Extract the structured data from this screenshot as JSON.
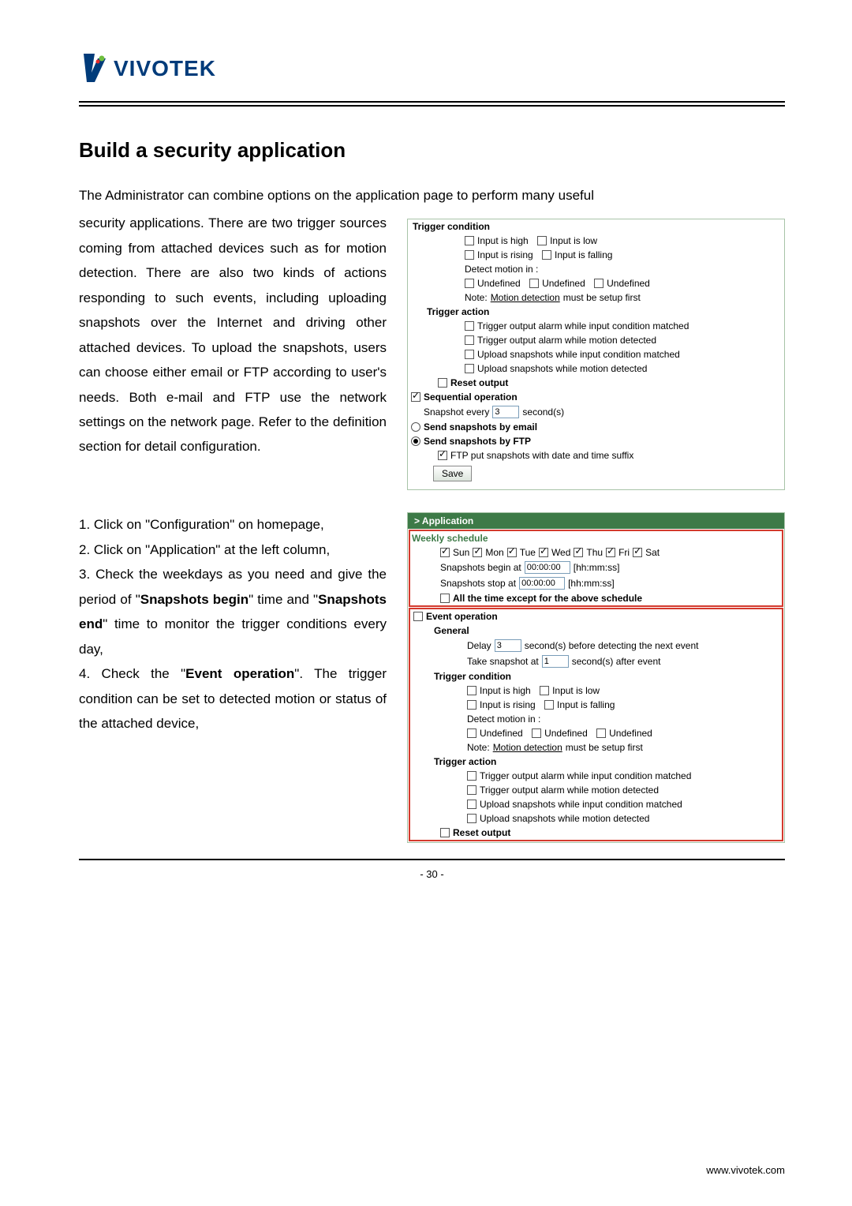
{
  "logo": {
    "brand": "VIVOTEK"
  },
  "h1": "Build a security application",
  "intro": "The Administrator can combine options on the application page to perform many useful",
  "para1": "security applications. There are two trigger sources coming from attached devices such as for motion detection. There are also two kinds of actions responding to such events, including uploading snapshots over the Internet and driving other attached devices. To upload the snapshots, users can choose either email or FTP according to user's needs. Both e-mail and FTP use the network settings on the network page. Refer to the definition section for detail configuration.",
  "steps": {
    "s1a": "1. Click on \"Configuration\" on homepage,",
    "s2": "2. Click on \"Application\" at the left column,",
    "s3a": "3. Check the weekdays as you need and give the period of \"",
    "s3b": "Snapshots begin",
    "s3c": "\" time and \"",
    "s3d": "Snapshots end",
    "s3e": "\" time to monitor the trigger conditions every day,",
    "s4a": "4. Check the \"",
    "s4b": "Event operation",
    "s4c": "\". The trigger condition can be set to detected motion or status of the attached device,"
  },
  "panel1": {
    "trigger_condition": "Trigger condition",
    "input_high": "Input is high",
    "input_low": "Input is low",
    "input_rising": "Input is rising",
    "input_falling": "Input is falling",
    "detect_motion": "Detect motion in :",
    "undef": "Undefined",
    "note_pre": "Note: ",
    "note_link": "Motion detection",
    "note_post": " must be setup first",
    "trigger_action": "Trigger action",
    "ta1": "Trigger output alarm while input condition matched",
    "ta2": "Trigger output alarm while motion detected",
    "ta3": "Upload snapshots while input condition matched",
    "ta4": "Upload snapshots while motion detected",
    "reset_output": "Reset output",
    "seq_op": "Sequential operation",
    "snap_every_pre": "Snapshot every",
    "snap_every_val": "3",
    "snap_every_post": "second(s)",
    "send_email": "Send snapshots by email",
    "send_ftp": "Send snapshots by FTP",
    "ftp_suffix": "FTP put snapshots with date and time suffix",
    "save": "Save"
  },
  "panel2": {
    "app_hdr": "> Application",
    "weekly": "Weekly schedule",
    "days": {
      "sun": "Sun",
      "mon": "Mon",
      "tue": "Tue",
      "wed": "Wed",
      "thu": "Thu",
      "fri": "Fri",
      "sat": "Sat"
    },
    "snap_begin_pre": "Snapshots begin at",
    "snap_begin_val": "00:00:00",
    "hhmmss": "[hh:mm:ss]",
    "snap_stop_pre": "Snapshots stop at",
    "snap_stop_val": "00:00:00",
    "all_time": "All the time except for the above schedule",
    "event_op": "Event operation",
    "general": "General",
    "delay_pre": "Delay",
    "delay_val": "3",
    "delay_post": "second(s) before detecting the next event",
    "take_pre": "Take snapshot at",
    "take_val": "1",
    "take_post": "second(s) after event"
  },
  "footer": {
    "page": "- 30 -",
    "site": "www.vivotek.com"
  }
}
